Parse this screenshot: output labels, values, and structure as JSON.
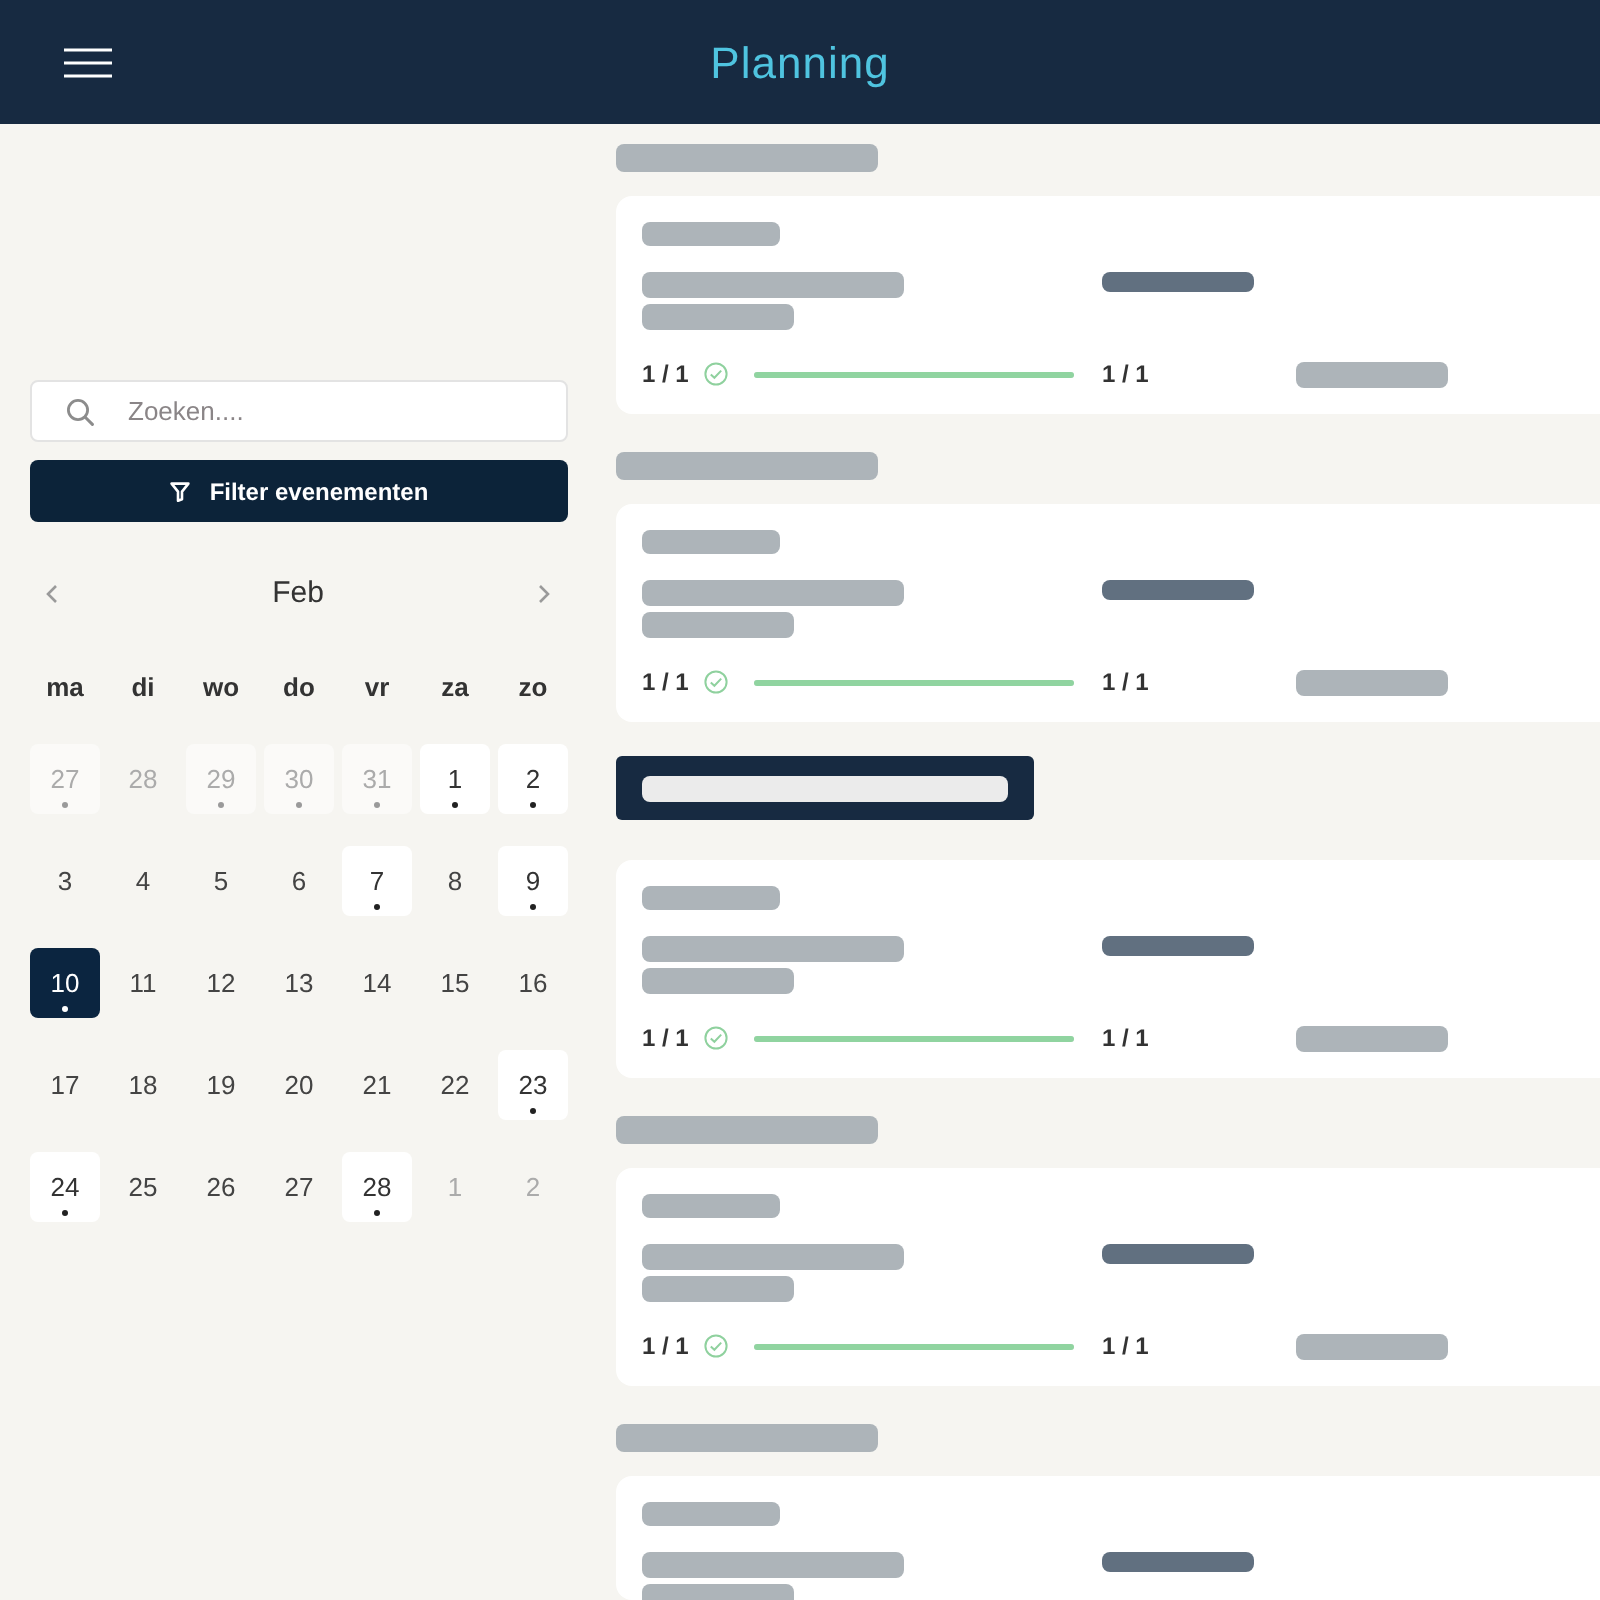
{
  "header": {
    "title": "Planning"
  },
  "search": {
    "placeholder": "Zoeken...."
  },
  "filter_button": {
    "label": "Filter evenementen"
  },
  "calendar": {
    "month": "Feb",
    "weekdays": [
      "ma",
      "di",
      "wo",
      "do",
      "vr",
      "za",
      "zo"
    ],
    "weeks": [
      [
        {
          "day": "27",
          "outside": true,
          "has_event": true,
          "selected": false
        },
        {
          "day": "28",
          "outside": true,
          "has_event": false,
          "selected": false
        },
        {
          "day": "29",
          "outside": true,
          "has_event": true,
          "selected": false
        },
        {
          "day": "30",
          "outside": true,
          "has_event": true,
          "selected": false
        },
        {
          "day": "31",
          "outside": true,
          "has_event": true,
          "selected": false
        },
        {
          "day": "1",
          "outside": false,
          "has_event": true,
          "selected": false
        },
        {
          "day": "2",
          "outside": false,
          "has_event": true,
          "selected": false
        }
      ],
      [
        {
          "day": "3",
          "outside": false,
          "has_event": false,
          "selected": false
        },
        {
          "day": "4",
          "outside": false,
          "has_event": false,
          "selected": false
        },
        {
          "day": "5",
          "outside": false,
          "has_event": false,
          "selected": false
        },
        {
          "day": "6",
          "outside": false,
          "has_event": false,
          "selected": false
        },
        {
          "day": "7",
          "outside": false,
          "has_event": true,
          "selected": false
        },
        {
          "day": "8",
          "outside": false,
          "has_event": false,
          "selected": false
        },
        {
          "day": "9",
          "outside": false,
          "has_event": true,
          "selected": false
        }
      ],
      [
        {
          "day": "10",
          "outside": false,
          "has_event": true,
          "selected": true
        },
        {
          "day": "11",
          "outside": false,
          "has_event": false,
          "selected": false
        },
        {
          "day": "12",
          "outside": false,
          "has_event": false,
          "selected": false
        },
        {
          "day": "13",
          "outside": false,
          "has_event": false,
          "selected": false
        },
        {
          "day": "14",
          "outside": false,
          "has_event": false,
          "selected": false
        },
        {
          "day": "15",
          "outside": false,
          "has_event": false,
          "selected": false
        },
        {
          "day": "16",
          "outside": false,
          "has_event": false,
          "selected": false
        }
      ],
      [
        {
          "day": "17",
          "outside": false,
          "has_event": false,
          "selected": false
        },
        {
          "day": "18",
          "outside": false,
          "has_event": false,
          "selected": false
        },
        {
          "day": "19",
          "outside": false,
          "has_event": false,
          "selected": false
        },
        {
          "day": "20",
          "outside": false,
          "has_event": false,
          "selected": false
        },
        {
          "day": "21",
          "outside": false,
          "has_event": false,
          "selected": false
        },
        {
          "day": "22",
          "outside": false,
          "has_event": false,
          "selected": false
        },
        {
          "day": "23",
          "outside": false,
          "has_event": true,
          "selected": false
        }
      ],
      [
        {
          "day": "24",
          "outside": false,
          "has_event": true,
          "selected": false
        },
        {
          "day": "25",
          "outside": false,
          "has_event": false,
          "selected": false
        },
        {
          "day": "26",
          "outside": false,
          "has_event": false,
          "selected": false
        },
        {
          "day": "27",
          "outside": false,
          "has_event": false,
          "selected": false
        },
        {
          "day": "28",
          "outside": false,
          "has_event": true,
          "selected": false
        },
        {
          "day": "1",
          "outside": true,
          "has_event": false,
          "selected": false
        },
        {
          "day": "2",
          "outside": true,
          "has_event": false,
          "selected": false
        }
      ]
    ]
  },
  "sections": [
    {
      "highlighted": false,
      "progress": {
        "left_count": "1 / 1",
        "done": true,
        "level": 1,
        "right_count": "1 / 1"
      }
    },
    {
      "highlighted": false,
      "progress": {
        "left_count": "1 / 1",
        "done": true,
        "level": 1,
        "right_count": "1 / 1"
      }
    },
    {
      "highlighted": true,
      "progress": {
        "left_count": "1 / 1",
        "done": true,
        "level": 1,
        "right_count": "1 / 1"
      }
    },
    {
      "highlighted": false,
      "progress": {
        "left_count": "1 / 1",
        "done": true,
        "level": 1,
        "right_count": "1 / 1"
      }
    },
    {
      "highlighted": false
    }
  ]
}
